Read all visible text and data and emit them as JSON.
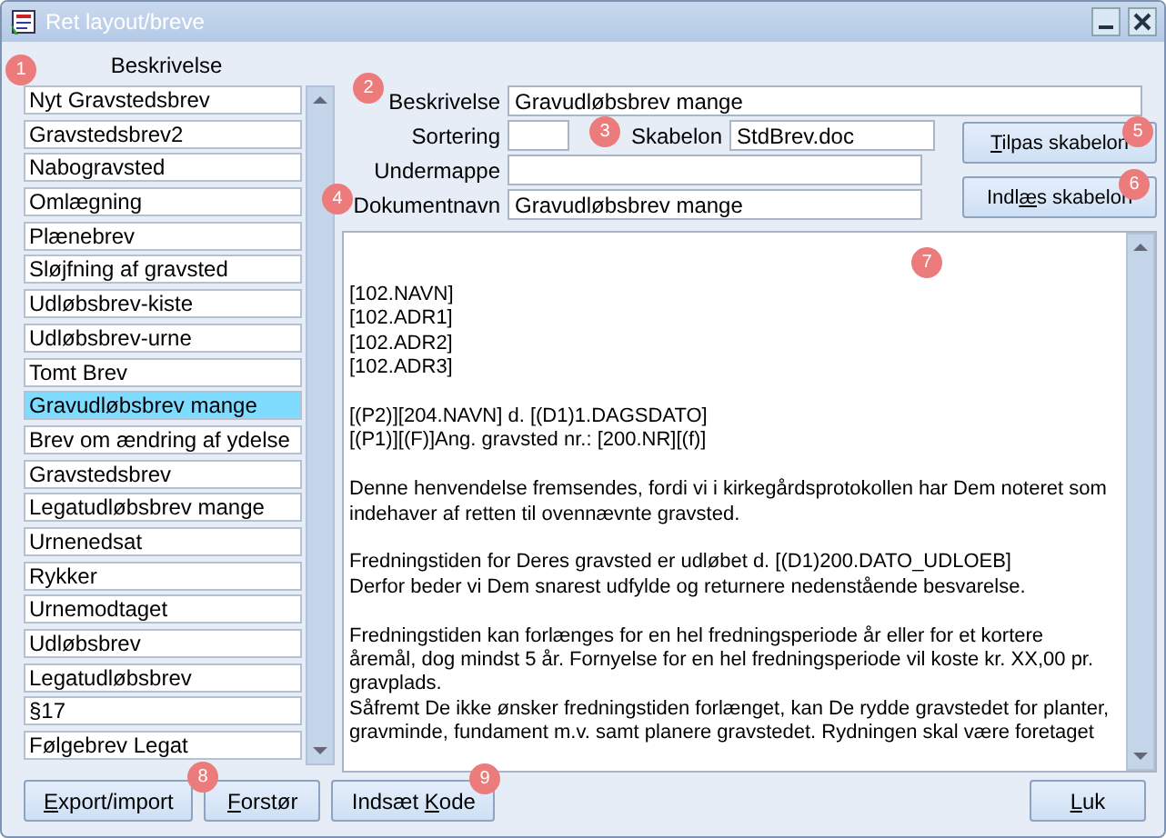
{
  "window": {
    "title": "Ret layout/breve",
    "active": false
  },
  "list": {
    "heading": "Beskrivelse",
    "items": [
      {
        "label": "Nyt Gravstedsbrev",
        "selected": false
      },
      {
        "label": "Gravstedsbrev2",
        "selected": false
      },
      {
        "label": "Nabogravsted",
        "selected": false
      },
      {
        "label": "Omlægning",
        "selected": false
      },
      {
        "label": "Plænebrev",
        "selected": false
      },
      {
        "label": "Sløjfning af gravsted",
        "selected": false
      },
      {
        "label": "Udløbsbrev-kiste",
        "selected": false
      },
      {
        "label": "Udløbsbrev-urne",
        "selected": false
      },
      {
        "label": "Tomt Brev",
        "selected": false
      },
      {
        "label": "Gravudløbsbrev mange",
        "selected": true
      },
      {
        "label": "Brev om ændring af ydelse",
        "selected": false
      },
      {
        "label": "Gravstedsbrev",
        "selected": false
      },
      {
        "label": "Legatudløbsbrev mange",
        "selected": false
      },
      {
        "label": "Urnenedsat",
        "selected": false
      },
      {
        "label": "Rykker",
        "selected": false
      },
      {
        "label": "Urnemodtaget",
        "selected": false
      },
      {
        "label": "Udløbsbrev",
        "selected": false
      },
      {
        "label": "Legatudløbsbrev",
        "selected": false
      },
      {
        "label": "§17",
        "selected": false
      },
      {
        "label": "Følgebrev Legat",
        "selected": false
      }
    ]
  },
  "form": {
    "beskrivelse": {
      "label": "Beskrivelse",
      "value": "Gravudløbsbrev mange"
    },
    "sortering": {
      "label": "Sortering"
    },
    "skabelon": {
      "label": "Skabelon",
      "value": "StdBrev.doc"
    },
    "undermappe": {
      "label": "Undermappe"
    },
    "dokumentnavn": {
      "label": "Dokumentnavn",
      "value": "Gravudløbsbrev mange"
    }
  },
  "side_buttons": [
    {
      "access_key": "T",
      "label_after": "ilpas skabelon"
    },
    {
      "label_before": "Indl",
      "access_key": "æ",
      "label_after": "s skabelon"
    }
  ],
  "document_text": [
    [
      "[102.NAVN]",
      "[102.ADR1]",
      "[102.ADR2]",
      "[102.ADR3]"
    ],
    [
      "[(P2)][204.NAVN] d. [(D1)1.DAGSDATO]",
      "[(P1)][(F)]Ang. gravsted nr.: [200.NR][(f)]"
    ],
    [
      "Denne henvendelse fremsendes, fordi vi i kirkegårdsprotokollen har Dem noteret som",
      "indehaver af retten til ovennævnte gravsted."
    ],
    [
      "Fredningstiden for Deres gravsted er udløbet d. [(D1)200.DATO_UDLOEB]",
      "Derfor beder vi Dem snarest udfylde og returnere nedenstående besvarelse."
    ],
    [
      "Fredningstiden kan forlænges for en hel fredningsperiode  år eller for et kortere",
      "åremål, dog mindst 5 år. Fornyelse for en hel fredningsperiode vil koste kr. XX,00 pr.",
      "gravplads.",
      "Såfremt De ikke ønsker fredningstiden forlænget, kan De rydde gravstedet for planter,",
      "gravminde, fundament m.v. samt planere gravstedet. Rydningen skal være foretaget"
    ]
  ],
  "bottom_buttons": [
    {
      "access_key": "E",
      "label_after": "xport/import"
    },
    {
      "access_key": "F",
      "label_after": "orstør"
    },
    {
      "label_before": "Indsæt ",
      "access_key": "K",
      "label_after": "ode"
    },
    {
      "access_key": "L",
      "label_after": "uk"
    }
  ],
  "markers": [
    "1",
    "2",
    "3",
    "4",
    "5",
    "6",
    "7",
    "8",
    "9"
  ]
}
